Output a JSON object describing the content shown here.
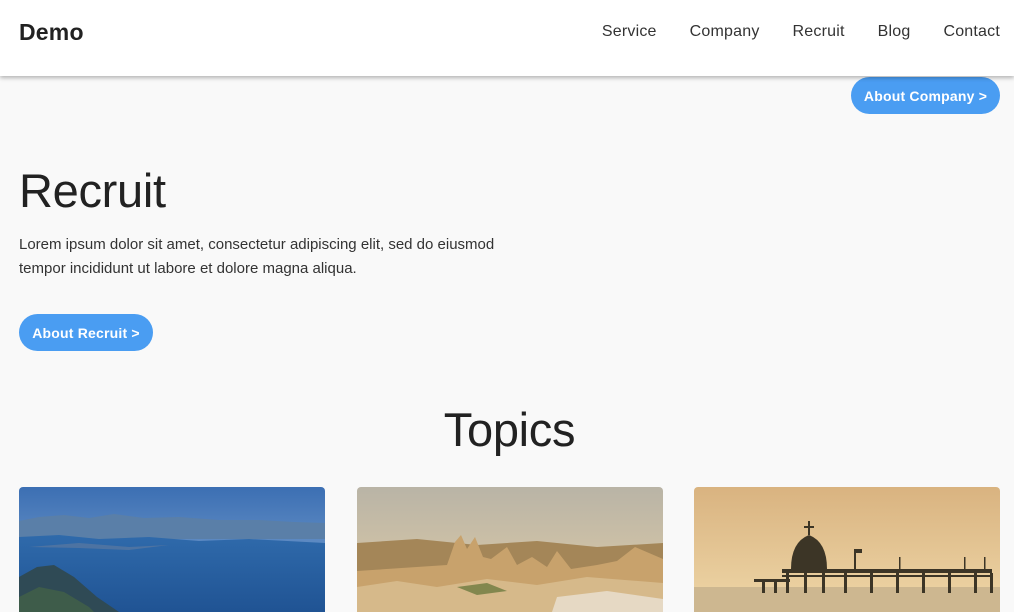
{
  "header": {
    "logo": "Demo",
    "nav": [
      "Service",
      "Company",
      "Recruit",
      "Blog",
      "Contact"
    ]
  },
  "company_button": "About Company >",
  "recruit": {
    "title": "Recruit",
    "text": "Lorem ipsum dolor sit amet, consectetur adipiscing elit, sed do eiusmod tempor incididunt ut labore et dolore magna aliqua.",
    "button": "About Recruit >"
  },
  "topics": {
    "title": "Topics"
  },
  "colors": {
    "accent": "#4a9df2",
    "background": "#f9f9f9",
    "header": "#ffffff",
    "text": "#222222"
  }
}
